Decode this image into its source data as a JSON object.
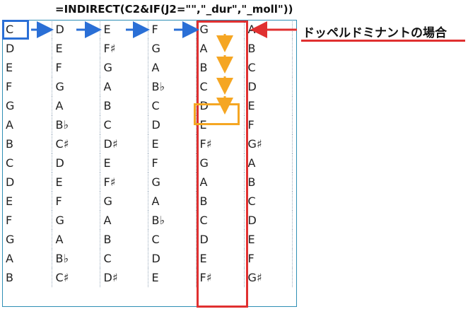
{
  "formula": "=INDIRECT(C2&IF(J2=\"\",\"_dur\",\"_moll\"))",
  "callout": "ドッペルドミナントの場合",
  "colors": {
    "blue": "#2a6fd6",
    "red": "#e03030",
    "orange": "#f5a623",
    "grid_border": "#2f8fb5"
  },
  "rows": [
    [
      "C",
      "D",
      "E",
      "F",
      "G",
      "A"
    ],
    [
      "D",
      "E",
      "F♯",
      "G",
      "A",
      "B"
    ],
    [
      "E",
      "F",
      "G",
      "A",
      "B",
      "C"
    ],
    [
      "F",
      "G",
      "A",
      "B♭",
      "C",
      "D"
    ],
    [
      "G",
      "A",
      "B",
      "C",
      "D",
      "E"
    ],
    [
      "A",
      "B♭",
      "C",
      "D",
      "E",
      "F"
    ],
    [
      "B",
      "C♯",
      "D♯",
      "E",
      "F♯",
      "G♯"
    ],
    [
      "C",
      "D",
      "E",
      "F",
      "G",
      "A"
    ],
    [
      "D",
      "E",
      "F♯",
      "G",
      "A",
      "B"
    ],
    [
      "E",
      "F",
      "G",
      "A",
      "B",
      "C"
    ],
    [
      "F",
      "G",
      "A",
      "B♭",
      "C",
      "D"
    ],
    [
      "G",
      "A",
      "B",
      "C",
      "D",
      "E"
    ],
    [
      "A",
      "B♭",
      "C",
      "D",
      "E",
      "F"
    ],
    [
      "B",
      "C♯",
      "D♯",
      "E",
      "F♯",
      "G♯"
    ]
  ]
}
